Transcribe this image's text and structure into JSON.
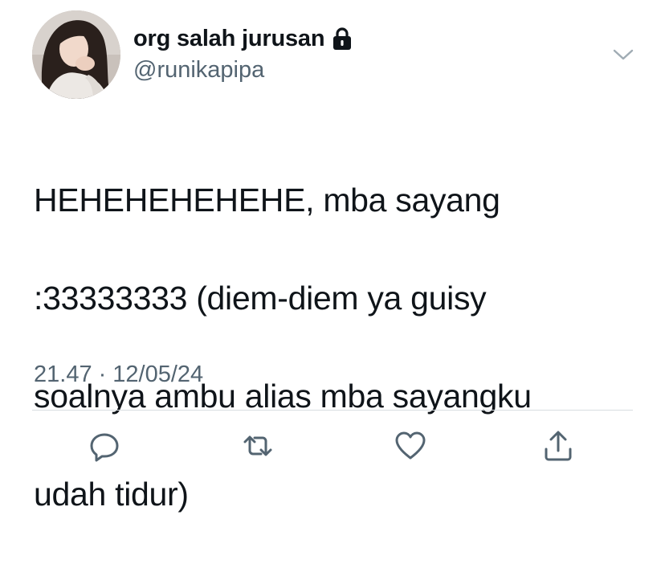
{
  "tweet": {
    "display_name": "org salah jurusan",
    "handle": "@runikapipa",
    "text_lines": [
      "HEHEHEHEHEHE, mba sayang",
      ":33333333 (diem-diem ya guisy",
      "soalnya ambu alias mba sayangku",
      "udah tidur)"
    ],
    "time": "21.47",
    "separator": "·",
    "date": "12/05/24"
  },
  "icons": {
    "lock": "lock-icon",
    "menu": "chevron-down-icon",
    "reply": "reply-icon",
    "retweet": "retweet-icon",
    "like": "heart-icon",
    "share": "share-icon"
  },
  "colors": {
    "text": "#0f1419",
    "secondary": "#536471",
    "divider": "#d8dde1",
    "icon": "#536471"
  }
}
